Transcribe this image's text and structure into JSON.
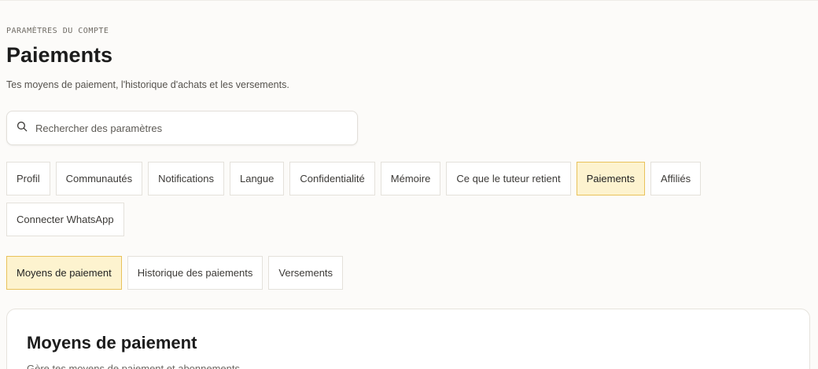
{
  "header": {
    "eyebrow": "PARAMÈTRES DU COMPTE",
    "title": "Paiements",
    "subtitle": "Tes moyens de paiement, l'historique d'achats et les versements."
  },
  "search": {
    "placeholder": "Rechercher des paramètres",
    "icon": "search-icon"
  },
  "settings_tabs": [
    {
      "label": "Profil",
      "active": false
    },
    {
      "label": "Communautés",
      "active": false
    },
    {
      "label": "Notifications",
      "active": false
    },
    {
      "label": "Langue",
      "active": false
    },
    {
      "label": "Confidentialité",
      "active": false
    },
    {
      "label": "Mémoire",
      "active": false
    },
    {
      "label": "Ce que le tuteur retient",
      "active": false
    },
    {
      "label": "Paiements",
      "active": true
    },
    {
      "label": "Affiliés",
      "active": false
    },
    {
      "label": "Connecter WhatsApp",
      "active": false
    }
  ],
  "payment_tabs": [
    {
      "label": "Moyens de paiement",
      "active": true
    },
    {
      "label": "Historique des paiements",
      "active": false
    },
    {
      "label": "Versements",
      "active": false
    }
  ],
  "card": {
    "title": "Moyens de paiement",
    "subtitle": "Gère tes moyens de paiement et abonnements."
  },
  "colors": {
    "background": "#fcfbf9",
    "active_tab_bg": "#fdf3cf",
    "active_tab_border": "#e9c25a"
  }
}
